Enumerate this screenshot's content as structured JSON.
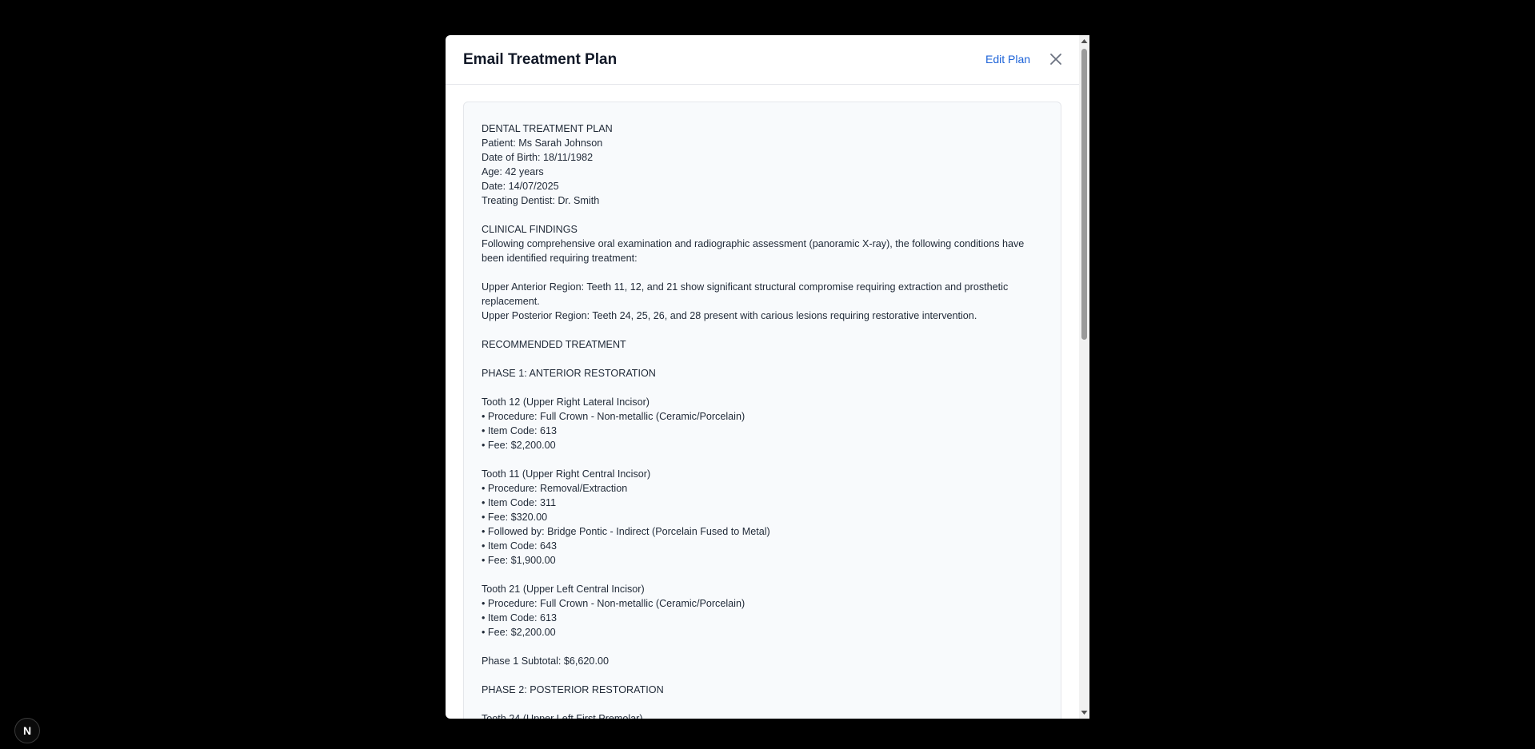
{
  "modal": {
    "title": "Email Treatment Plan",
    "edit_label": "Edit Plan",
    "close_icon": "close-icon"
  },
  "plan": {
    "lines": [
      "DENTAL TREATMENT PLAN",
      "Patient: Ms Sarah Johnson",
      "Date of Birth: 18/11/1982",
      "Age: 42 years",
      "Date: 14/07/2025",
      "Treating Dentist: Dr. Smith",
      "",
      "CLINICAL FINDINGS",
      "Following comprehensive oral examination and radiographic assessment (panoramic X-ray), the following conditions have been identified requiring treatment:",
      "",
      "Upper Anterior Region: Teeth 11, 12, and 21 show significant structural compromise requiring extraction and prosthetic replacement.",
      "Upper Posterior Region: Teeth 24, 25, 26, and 28 present with carious lesions requiring restorative intervention.",
      "",
      "RECOMMENDED TREATMENT",
      "",
      "PHASE 1: ANTERIOR RESTORATION",
      "",
      "Tooth 12 (Upper Right Lateral Incisor)",
      "• Procedure: Full Crown - Non-metallic (Ceramic/Porcelain)",
      "• Item Code: 613",
      "• Fee: $2,200.00",
      "",
      "Tooth 11 (Upper Right Central Incisor)",
      "• Procedure: Removal/Extraction",
      "• Item Code: 311",
      "• Fee: $320.00",
      "• Followed by: Bridge Pontic - Indirect (Porcelain Fused to Metal)",
      "• Item Code: 643",
      "• Fee: $1,900.00",
      "",
      "Tooth 21 (Upper Left Central Incisor)",
      "• Procedure: Full Crown - Non-metallic (Ceramic/Porcelain)",
      "• Item Code: 613",
      "• Fee: $2,200.00",
      "",
      "Phase 1 Subtotal: $6,620.00",
      "",
      "PHASE 2: POSTERIOR RESTORATION",
      "",
      "Tooth 24 (Upper Left First Premolar)"
    ]
  },
  "badge": {
    "label": "N"
  },
  "colors": {
    "accent": "#1d63d8",
    "backdrop": "#000000",
    "panel": "#f8fafc"
  }
}
